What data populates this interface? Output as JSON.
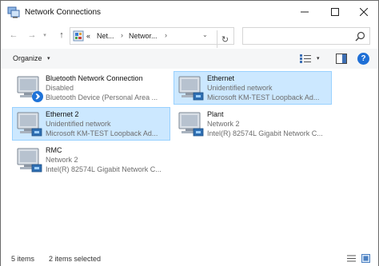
{
  "window": {
    "title": "Network Connections"
  },
  "titlebar_buttons": {
    "minimize": "—",
    "maximize": "☐",
    "close": "✕"
  },
  "nav": {
    "back": "←",
    "forward": "→",
    "recent": "▾",
    "up": "↑",
    "refresh": "↻"
  },
  "address": {
    "overflow": "«",
    "crumb1": "Net...",
    "crumb2": "Networ...",
    "sep": "›",
    "dropdown": "⌄"
  },
  "search": {
    "placeholder": ""
  },
  "toolbar": {
    "organize": "Organize",
    "caret": "▾",
    "help": "?"
  },
  "items": [
    {
      "name": "Bluetooth Network Connection",
      "status": "Disabled",
      "device": "Bluetooth Device (Personal Area ...",
      "selected": false,
      "icon": "bluetooth-adapter-icon"
    },
    {
      "name": "Ethernet",
      "status": "Unidentified network",
      "device": "Microsoft KM-TEST Loopback Ad...",
      "selected": true,
      "icon": "ethernet-adapter-icon"
    },
    {
      "name": "Ethernet 2",
      "status": "Unidentified network",
      "device": "Microsoft KM-TEST Loopback Ad...",
      "selected": true,
      "icon": "ethernet-adapter-icon"
    },
    {
      "name": "Plant",
      "status": "Network 2",
      "device": "Intel(R) 82574L Gigabit Network C...",
      "selected": false,
      "icon": "ethernet-adapter-icon"
    },
    {
      "name": "RMC",
      "status": "Network 2",
      "device": "Intel(R) 82574L Gigabit Network C...",
      "selected": false,
      "icon": "ethernet-adapter-icon"
    }
  ],
  "statusbar": {
    "count": "5 items",
    "selected": "2 items selected"
  },
  "colors": {
    "selection_bg": "#cce8ff",
    "selection_border": "#99d1ff",
    "accent": "#1e6fd6"
  }
}
